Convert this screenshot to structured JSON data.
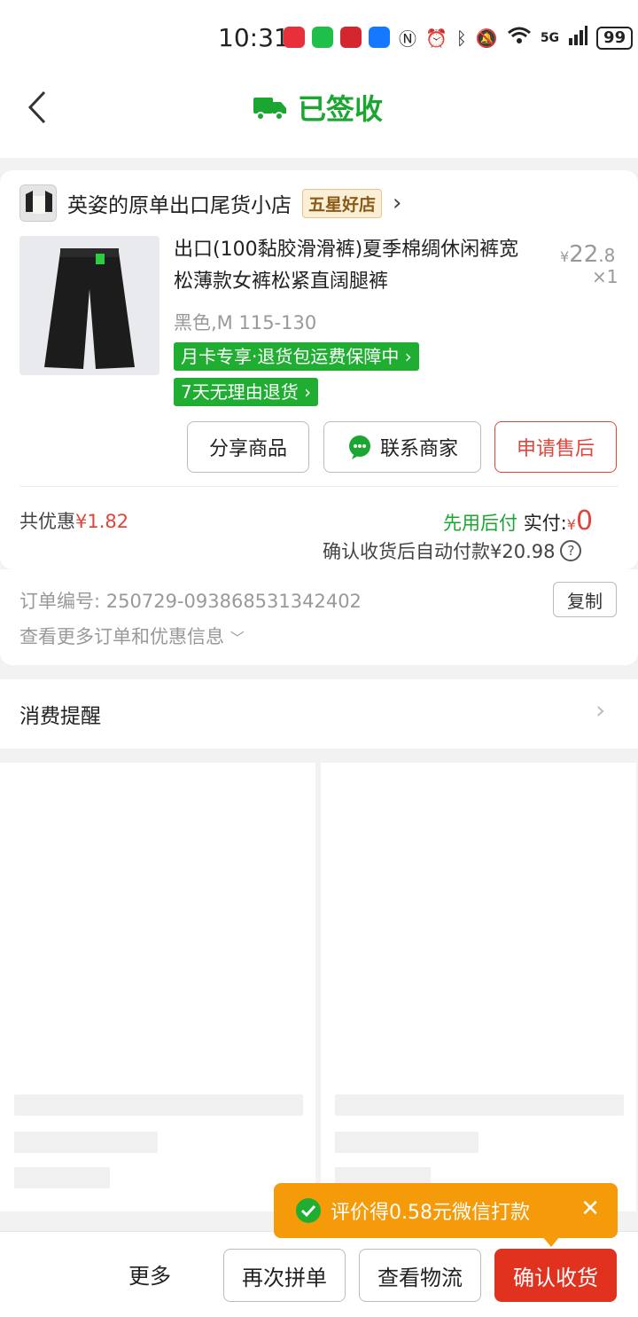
{
  "status_bar": {
    "time": "10:31",
    "network": "5G",
    "battery": "99"
  },
  "nav": {
    "title": "已签收",
    "icons": {
      "back": "chevron-left-icon",
      "truck": "truck-icon"
    }
  },
  "shop": {
    "name": "英姿的原单出口尾货小店",
    "badge": "五星好店"
  },
  "product": {
    "title": "出口(100黏胶滑滑裤)夏季棉绸休闲裤宽松薄款女裤松紧直阔腿裤",
    "price_symbol": "¥",
    "price_int": "22",
    "price_dec": ".8",
    "quantity": "×1",
    "sku": "黑色,M 115-130",
    "tags": [
      "月卡专享·退货包运费保障中",
      "7天无理由退货"
    ]
  },
  "actions": {
    "share": "分享商品",
    "contact": "联系商家",
    "after_sale": "申请售后"
  },
  "summary": {
    "discount_label": "共优惠",
    "discount_amount": "¥1.82",
    "pay_later": "先用后付",
    "actual_label": "实付:",
    "actual_symbol": "¥",
    "actual_amount": "0",
    "auto_pay": "确认收货后自动付款¥20.98"
  },
  "order": {
    "number_label": "订单编号:",
    "number": "250729-093868531342402",
    "copy": "复制",
    "more_info": "查看更多订单和优惠信息"
  },
  "reminder": {
    "label": "消费提醒"
  },
  "toast": {
    "text": "评价得0.58元微信打款"
  },
  "bottom_bar": {
    "more": "更多",
    "reorder": "再次拼单",
    "logistics": "查看物流",
    "confirm": "确认收货"
  },
  "colors": {
    "green": "#1aa631",
    "red": "#e0453b",
    "orange": "#f59b0a"
  }
}
